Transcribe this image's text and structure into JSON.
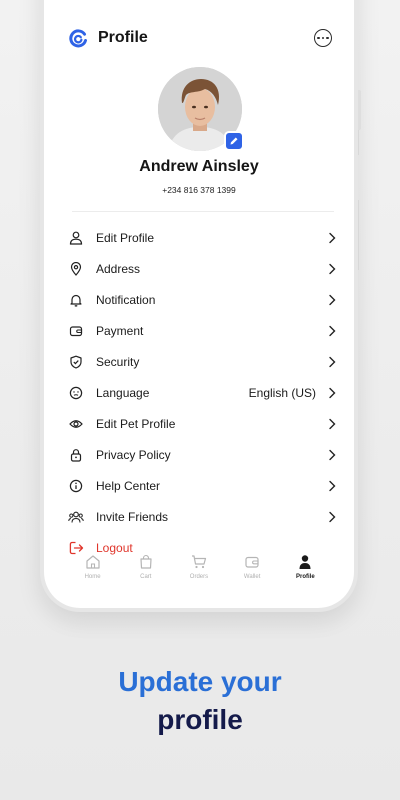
{
  "header": {
    "title": "Profile"
  },
  "profile": {
    "name": "Andrew Ainsley",
    "phone": "+234 816 378 1399"
  },
  "menu": {
    "items": [
      {
        "label": "Edit Profile",
        "icon": "user-icon"
      },
      {
        "label": "Address",
        "icon": "location-pin-icon"
      },
      {
        "label": "Notification",
        "icon": "bell-icon"
      },
      {
        "label": "Payment",
        "icon": "wallet-icon"
      },
      {
        "label": "Security",
        "icon": "shield-check-icon"
      },
      {
        "label": "Language",
        "icon": "language-icon",
        "value": "English (US)"
      },
      {
        "label": "Edit Pet Profile",
        "icon": "eye-icon"
      },
      {
        "label": "Privacy Policy",
        "icon": "lock-icon"
      },
      {
        "label": "Help Center",
        "icon": "info-icon"
      },
      {
        "label": "Invite Friends",
        "icon": "users-icon"
      }
    ],
    "logout": {
      "label": "Logout",
      "icon": "logout-icon"
    }
  },
  "nav": {
    "items": [
      {
        "label": "Home",
        "icon": "home-icon"
      },
      {
        "label": "Cart",
        "icon": "bag-icon"
      },
      {
        "label": "Orders",
        "icon": "cart-icon"
      },
      {
        "label": "Wallet",
        "icon": "wallet-icon"
      },
      {
        "label": "Profile",
        "icon": "person-icon",
        "active": true
      }
    ]
  },
  "tagline": {
    "line1": "Update your",
    "line2": "profile"
  },
  "colors": {
    "accent": "#2f63e6",
    "tagline_blue": "#2a6fd6",
    "tagline_navy": "#141a4a",
    "logout_red": "#e0352b"
  }
}
